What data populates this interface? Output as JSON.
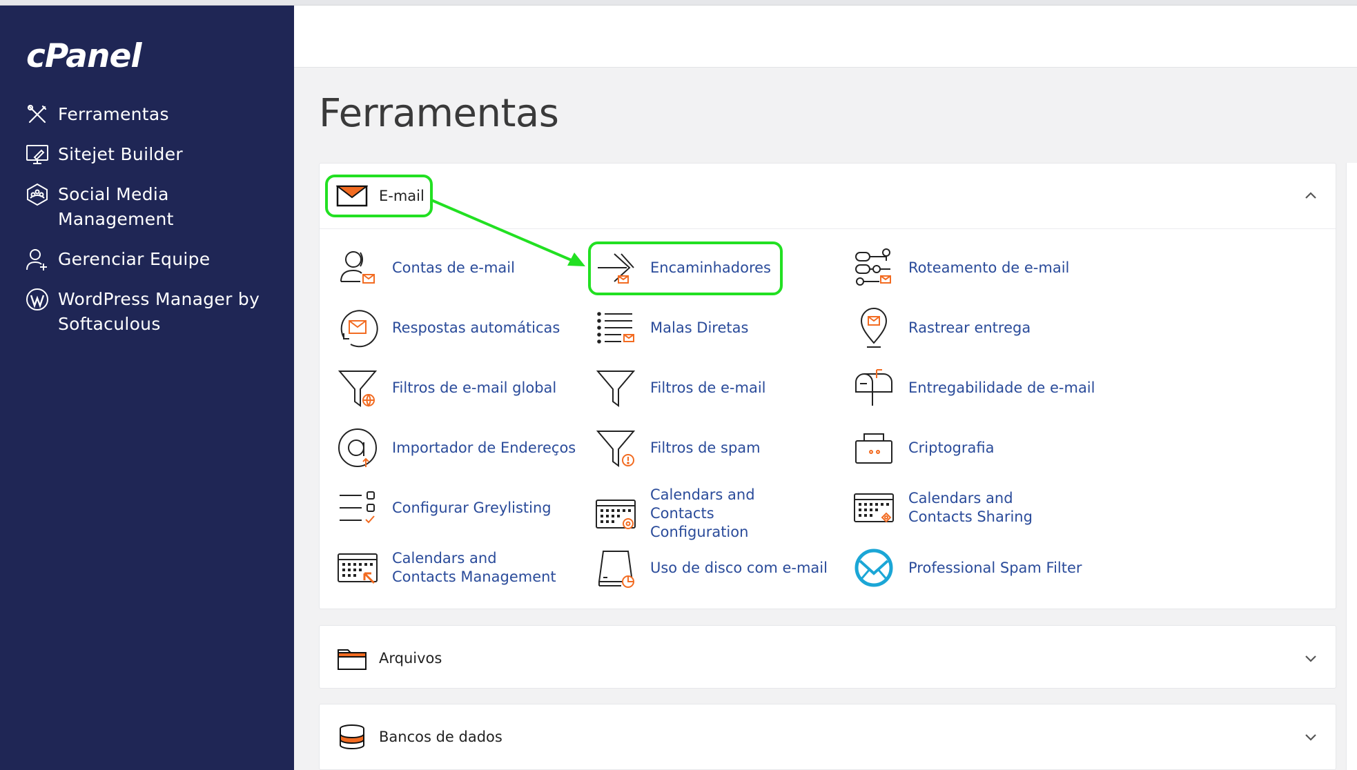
{
  "brand": {
    "logo_text": "cPanel"
  },
  "sidebar": {
    "items": [
      {
        "label": "Ferramentas",
        "icon": "tools-icon"
      },
      {
        "label": "Sitejet Builder",
        "icon": "monitor-builder-icon"
      },
      {
        "label": "Social Media Management",
        "icon": "social-media-icon"
      },
      {
        "label": "Gerenciar Equipe",
        "icon": "add-user-icon"
      },
      {
        "label": "WordPress Manager by Softaculous",
        "icon": "wordpress-icon"
      }
    ]
  },
  "page": {
    "title": "Ferramentas"
  },
  "sections": {
    "email": {
      "label": "E-mail",
      "expanded": true,
      "tools": [
        {
          "label": "Contas de e-mail",
          "icon": "email-accounts-icon"
        },
        {
          "label": "Encaminhadores",
          "icon": "forwarders-icon"
        },
        {
          "label": "Roteamento de e-mail",
          "icon": "email-routing-icon"
        },
        {
          "label": "Respostas automáticas",
          "icon": "autoresponders-icon"
        },
        {
          "label": "Malas Diretas",
          "icon": "mailing-lists-icon"
        },
        {
          "label": "Rastrear entrega",
          "icon": "track-delivery-icon"
        },
        {
          "label": "Filtros de e-mail global",
          "icon": "global-filter-icon"
        },
        {
          "label": "Filtros de e-mail",
          "icon": "email-filter-icon"
        },
        {
          "label": "Entregabilidade de e-mail",
          "icon": "deliverability-icon"
        },
        {
          "label": "Importador de Endereços",
          "icon": "address-importer-icon"
        },
        {
          "label": "Filtros de spam",
          "icon": "spam-filter-icon"
        },
        {
          "label": "Criptografia",
          "icon": "encryption-icon"
        },
        {
          "label": "Configurar Greylisting",
          "icon": "greylisting-icon"
        },
        {
          "label": "Calendars and Contacts Configuration",
          "icon": "calendar-config-icon"
        },
        {
          "label": "Calendars and Contacts Sharing",
          "icon": "calendar-sharing-icon"
        },
        {
          "label": "Calendars and Contacts Management",
          "icon": "calendar-management-icon"
        },
        {
          "label": "Uso de disco com e-mail",
          "icon": "disk-usage-icon"
        },
        {
          "label": "Professional Spam Filter",
          "icon": "professional-spam-filter-icon"
        }
      ]
    },
    "files": {
      "label": "Arquivos",
      "expanded": false
    },
    "databases": {
      "label": "Bancos de dados",
      "expanded": false
    }
  },
  "annotations": {
    "highlight_color": "#22e022",
    "highlighted": [
      "E-mail",
      "Encaminhadores"
    ]
  },
  "colors": {
    "sidebar_bg": "#1f2655",
    "link": "#2a4b9a",
    "accent_orange": "#f26b21"
  }
}
